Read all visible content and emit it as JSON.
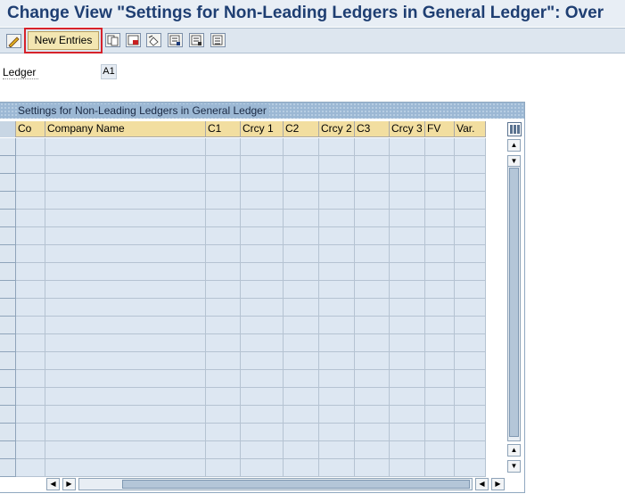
{
  "window": {
    "title": "Change View \"Settings for Non-Leading Ledgers in General Ledger\": Over"
  },
  "toolbar": {
    "new_entries_label": "New Entries",
    "icons": [
      "edit-pencil-icon",
      "copy-icon",
      "delete-icon",
      "undo-change-icon",
      "select-all-icon",
      "select-block-icon",
      "deselect-all-icon"
    ]
  },
  "header_fields": {
    "ledger_label": "Ledger",
    "ledger_value": "A1"
  },
  "table": {
    "title": "Settings for Non-Leading Ledgers in General Ledger",
    "columns": [
      "Co",
      "Company Name",
      "C1",
      "Crcy 1",
      "C2",
      "Crcy 2",
      "C3",
      "Crcy 3",
      "FV",
      "Var."
    ],
    "row_count": 19,
    "rows": []
  },
  "scrollbars": {
    "up_arrow": "▲",
    "down_arrow": "▼",
    "left_arrow": "◀",
    "right_arrow": "▶"
  },
  "colors": {
    "title_text": "#1e3e72",
    "header_band": "#9cb8d4",
    "column_header": "#f2dea0",
    "cell_background": "#dde7f2",
    "highlight_border": "#d6222b"
  }
}
